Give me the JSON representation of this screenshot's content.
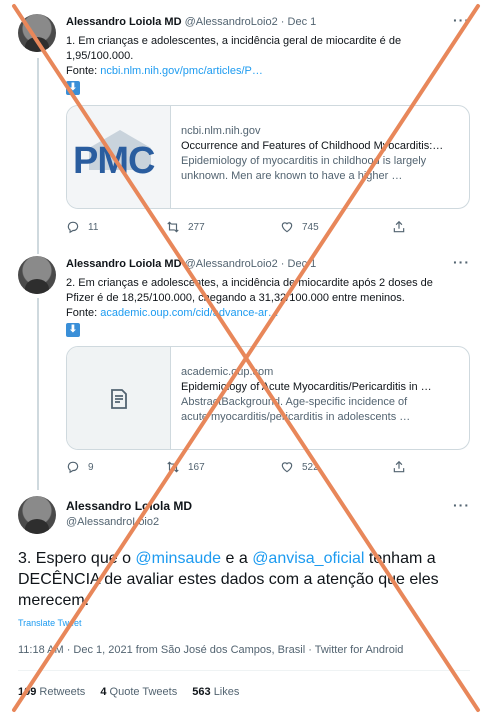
{
  "tweets": [
    {
      "name": "Alessandro Loiola MD",
      "handle": "@AlessandroLoio2",
      "dot": "·",
      "date": "Dec 1",
      "line1": "1. Em crianças e adolescentes, a incidência geral de miocardite é de",
      "line2": "1,95/100.000.",
      "source_label": "Fonte:",
      "source_link": "ncbi.nlm.nih.gov/pmc/articles/P…",
      "card": {
        "domain": "ncbi.nlm.nih.gov",
        "title": "Occurrence and Features of Childhood Myocarditis:…",
        "desc1": "Epidemiology of myocarditis in childhood is largely",
        "desc2": "unknown. Men are known to have a higher …",
        "logo": "PMC"
      },
      "replies": "11",
      "retweets": "277",
      "likes": "745"
    },
    {
      "name": "Alessandro Loiola MD",
      "handle": "@AlessandroLoio2",
      "dot": "·",
      "date": "Dec 1",
      "line1": "2. Em crianças e adolescentes, a incidência de miocardite após 2 doses de",
      "line2": "Pfizer é de 18,25/100.000, chegando a 31,32/100.000 entre meninos.",
      "source_label": "Fonte:",
      "source_link": "academic.oup.com/cid/advance-ar…",
      "card": {
        "domain": "academic.oup.com",
        "title": "Epidemiology of Acute Myocarditis/Pericarditis in …",
        "desc1": "AbstractBackground. Age-specific incidence of",
        "desc2": "acute myocarditis/pericarditis in adolescents …"
      },
      "replies": "9",
      "retweets": "167",
      "likes": "522"
    }
  ],
  "main_tweet": {
    "name": "Alessandro Loiola MD",
    "handle": "@AlessandroLoio2",
    "text_prefix": "3. Espero que o ",
    "mention1": "@minsaude",
    "text_mid": " e a ",
    "mention2": "@anvisa_oficial",
    "text_rest": " tenham a DECÊNCIA de avaliar estes dados com a atenção que eles merecem.",
    "translate": "Translate Tweet",
    "meta": "11:18 AM · Dec 1, 2021 from São José dos Campos, Brasil · Twitter for Android",
    "retweets_count": "109",
    "retweets_label": "Retweets",
    "quotes_count": "4",
    "quotes_label": "Quote Tweets",
    "likes_count": "563",
    "likes_label": "Likes"
  },
  "more_glyph": "···",
  "download_glyph": "⬇",
  "colors": {
    "link": "#1d9bf0",
    "cross": "#e8875a",
    "text": "#0f1419",
    "muted": "#536471"
  }
}
